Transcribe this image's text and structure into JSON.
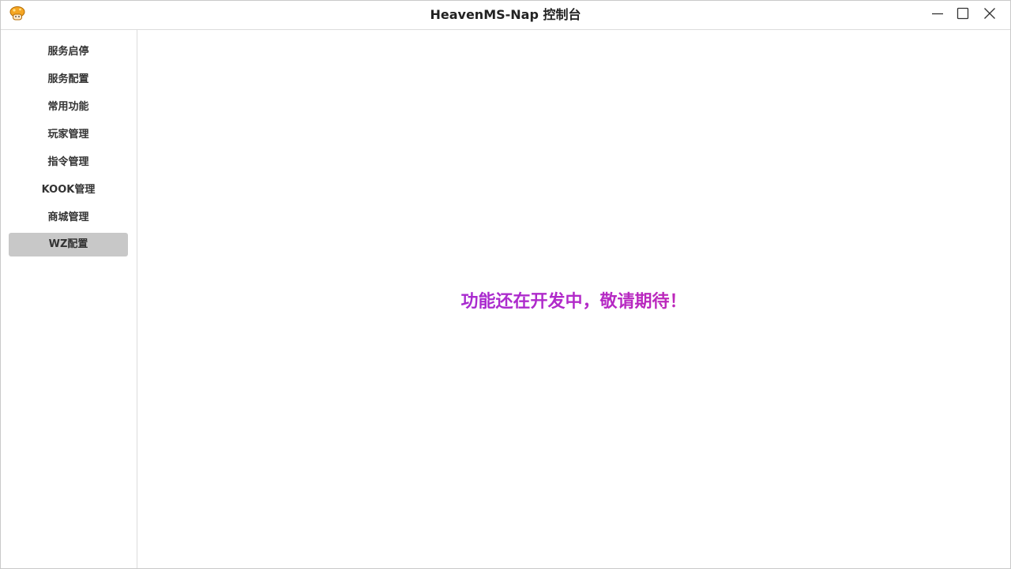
{
  "window": {
    "title": "HeavenMS-Nap 控制台",
    "app_icon": "mushroom-icon",
    "controls": {
      "minimize": "minimize-icon",
      "maximize": "maximize-icon",
      "close": "close-icon"
    }
  },
  "sidebar": {
    "items": [
      {
        "label": "服务启停",
        "active": false
      },
      {
        "label": "服务配置",
        "active": false
      },
      {
        "label": "常用功能",
        "active": false
      },
      {
        "label": "玩家管理",
        "active": false
      },
      {
        "label": "指令管理",
        "active": false
      },
      {
        "label": "KOOK管理",
        "active": false
      },
      {
        "label": "商城管理",
        "active": false
      },
      {
        "label": "WZ配置",
        "active": true
      }
    ],
    "active_bg": "#c8c8c8"
  },
  "main": {
    "message": "功能还在开发中，敬请期待！",
    "message_gradient": [
      "#8a2be2",
      "#e0218a"
    ]
  }
}
